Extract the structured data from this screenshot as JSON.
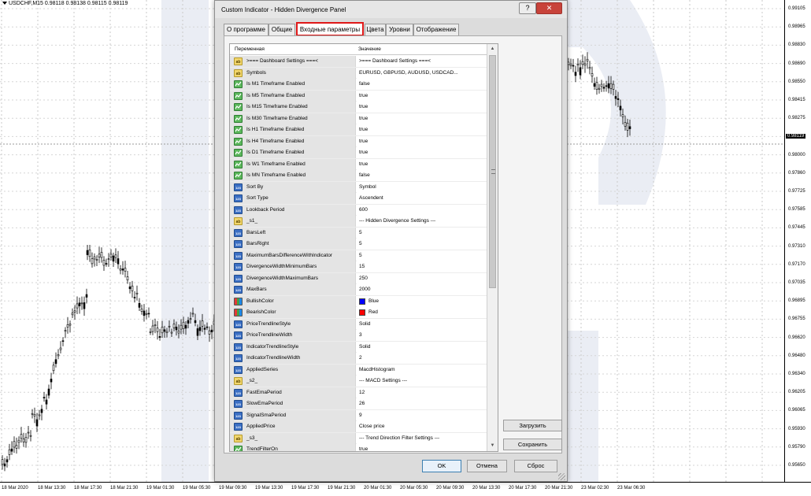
{
  "chart": {
    "symbol_label": "USDCHF,M15  0.98118 0.98138 0.98115 0.98119",
    "price_labels": [
      "0.99105",
      "0.98965",
      "0.98830",
      "0.98690",
      "0.98550",
      "0.98415",
      "0.98275",
      "0.98119",
      "0.98000",
      "0.97860",
      "0.97725",
      "0.97585",
      "0.97445",
      "0.97310",
      "0.97170",
      "0.97035",
      "0.96895",
      "0.96755",
      "0.96620",
      "0.96480",
      "0.96340",
      "0.96205",
      "0.96065",
      "0.95930",
      "0.95790",
      "0.95650"
    ],
    "time_labels": [
      "18 Mar 2020",
      "18 Mar 13:30",
      "18 Mar 17:30",
      "18 Mar 21:30",
      "19 Mar 01:30",
      "19 Mar 05:30",
      "19 Mar 09:30",
      "19 Mar 13:30",
      "19 Mar 17:30",
      "19 Mar 21:30",
      "20 Mar 01:30",
      "20 Mar 05:30",
      "20 Mar 09:30",
      "20 Mar 13:30",
      "20 Mar 17:30",
      "20 Mar 21:30",
      "23 Mar 02:30",
      "23 Mar 06:30"
    ]
  },
  "dialog": {
    "title": "Custom Indicator - Hidden Divergence Panel",
    "help_label": "?",
    "close_label": "✕",
    "tabs": [
      {
        "label": "О программе"
      },
      {
        "label": "Общие"
      },
      {
        "label": "Входные параметры"
      },
      {
        "label": "Цвета"
      },
      {
        "label": "Уровни"
      },
      {
        "label": "Отображение"
      }
    ],
    "active_tab": "Входные параметры",
    "grid": {
      "header_variable": "Переменная",
      "header_value": "Значение",
      "rows": [
        {
          "icon": "ab",
          "name": ">=== Dashboard Settings ===<",
          "value": ">=== Dashboard Settings ===<"
        },
        {
          "icon": "ab",
          "name": "Symbols",
          "value": "EURUSD, GBPUSD, AUDUSD, USDCAD..."
        },
        {
          "icon": "bool",
          "name": "Is M1 Timeframe Enabled",
          "value": "false"
        },
        {
          "icon": "bool",
          "name": "Is M5 Timeframe Enabled",
          "value": "true"
        },
        {
          "icon": "bool",
          "name": "Is M15 Timeframe Enabled",
          "value": "true"
        },
        {
          "icon": "bool",
          "name": "Is M30 Timeframe Enabled",
          "value": "true"
        },
        {
          "icon": "bool",
          "name": "Is H1 Timeframe Enabled",
          "value": "true"
        },
        {
          "icon": "bool",
          "name": "Is H4 Timeframe Enabled",
          "value": "true"
        },
        {
          "icon": "bool",
          "name": "Is D1 Timeframe Enabled",
          "value": "true"
        },
        {
          "icon": "bool",
          "name": "Is W1 Timeframe Enabled",
          "value": "true"
        },
        {
          "icon": "bool",
          "name": "Is MN Timeframe Enabled",
          "value": "false"
        },
        {
          "icon": "num",
          "name": "Sort By",
          "value": "Symbol"
        },
        {
          "icon": "num",
          "name": "Sort Type",
          "value": "Ascendent"
        },
        {
          "icon": "num",
          "name": "Lookback Period",
          "value": "600"
        },
        {
          "icon": "ab",
          "name": "_s1_",
          "value": "--- Hidden Divergence Settings ---"
        },
        {
          "icon": "num",
          "name": "BarsLeft",
          "value": "5"
        },
        {
          "icon": "num",
          "name": "BarsRight",
          "value": "5"
        },
        {
          "icon": "num",
          "name": "MaximumBarsDifferenceWithIndicator",
          "value": "5"
        },
        {
          "icon": "num",
          "name": "DivergenceWidthMinimumBars",
          "value": "15"
        },
        {
          "icon": "num",
          "name": "DivergenceWidthMaximumBars",
          "value": "250"
        },
        {
          "icon": "num",
          "name": "MaxBars",
          "value": "2000"
        },
        {
          "icon": "clr",
          "name": "BullishColor",
          "value": "Blue",
          "swatch": "#0000ff"
        },
        {
          "icon": "clr",
          "name": "BearishColor",
          "value": "Red",
          "swatch": "#ff0000"
        },
        {
          "icon": "num",
          "name": "PriceTrendlineStyle",
          "value": "Solid"
        },
        {
          "icon": "num",
          "name": "PriceTrendlineWidth",
          "value": "3"
        },
        {
          "icon": "num",
          "name": "IndicatorTrendlineStyle",
          "value": "Solid"
        },
        {
          "icon": "num",
          "name": "IndicatorTrendlineWidth",
          "value": "2"
        },
        {
          "icon": "num",
          "name": "AppliedSeries",
          "value": "MacdHistogram"
        },
        {
          "icon": "ab",
          "name": "_s2_",
          "value": "--- MACD Settings ---"
        },
        {
          "icon": "num",
          "name": "FastEmaPeriod",
          "value": "12"
        },
        {
          "icon": "num",
          "name": "SlowEmaPeriod",
          "value": "26"
        },
        {
          "icon": "num",
          "name": "SignalSmaPeriod",
          "value": "9"
        },
        {
          "icon": "num",
          "name": "AppliedPrice",
          "value": "Close price"
        },
        {
          "icon": "ab",
          "name": "_s3_",
          "value": "--- Trend Direction Filter Settings ---"
        },
        {
          "icon": "bool",
          "name": "TrendFilterOn",
          "value": "true"
        }
      ]
    },
    "load_label": "Загрузить",
    "save_label": "Сохранить",
    "ok_label": "OK",
    "cancel_label": "Отмена",
    "reset_label": "Сброс"
  },
  "colors": {
    "active_tab_border": "#e01818",
    "close_button": "#c8433a",
    "watermark": "#dfe4ee"
  }
}
